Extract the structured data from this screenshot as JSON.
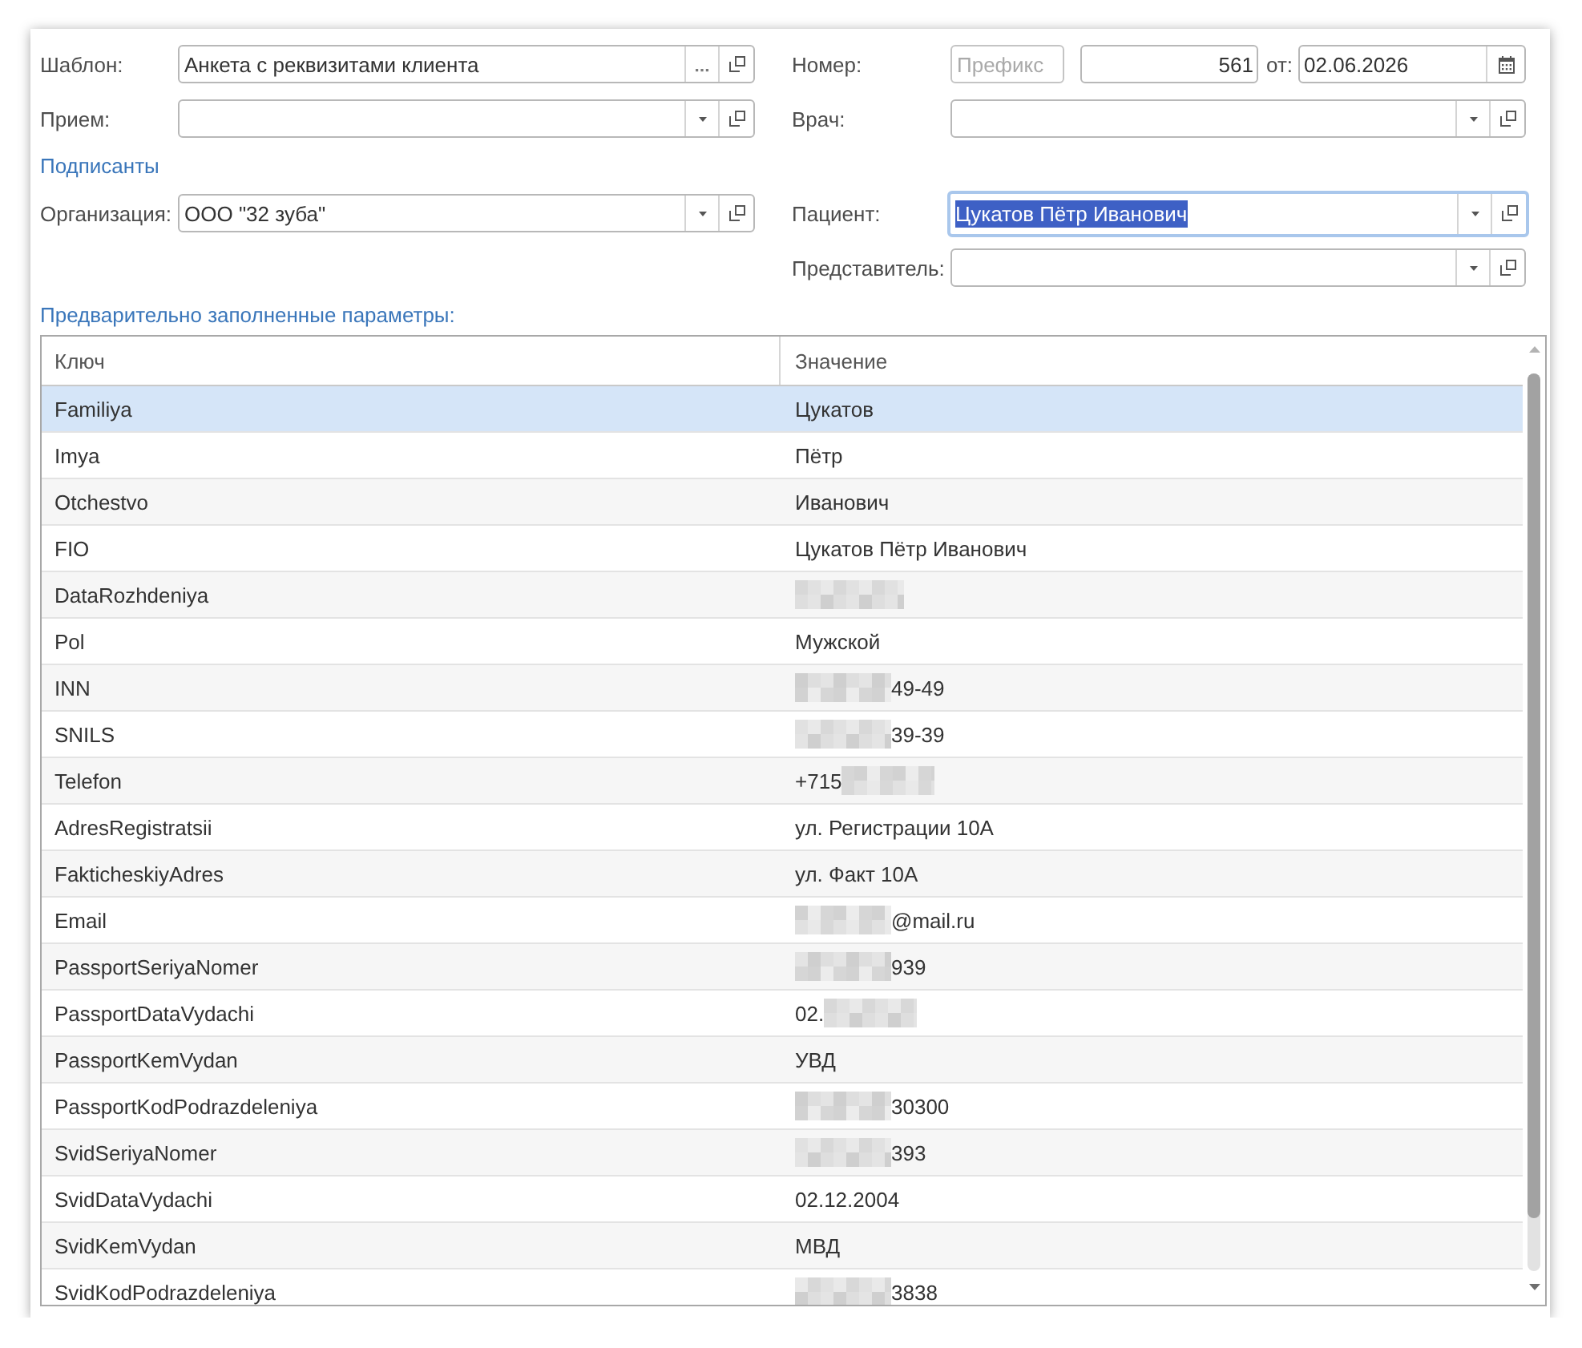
{
  "top_fields": {
    "left": [
      {
        "kind": "choice",
        "label": "Шаблон:",
        "value": "Анкета с реквизитами клиента",
        "focused": false
      },
      {
        "kind": "dropdown",
        "label": "Прием:",
        "focused": false
      }
    ],
    "right": [
      {
        "kind": "number",
        "label": "Номер:",
        "prefix": {
          "placeholder": "Префикс"
        },
        "number": "561",
        "date_label": "от:",
        "date": "02.06.2026"
      },
      {
        "kind": "dropdown",
        "label": "Врач:",
        "focused": false
      }
    ]
  },
  "signatories": {
    "title": "Подписанты",
    "left": [
      {
        "kind": "dropdown",
        "label": "Организация:",
        "value": "ООО \"32 зуба\"",
        "focused": false
      }
    ],
    "right": [
      {
        "kind": "dropdown",
        "label": "Пациент:",
        "value": "Цукатов Пётр Иванович",
        "focused": true
      },
      {
        "kind": "dropdown",
        "label": "Представитель:",
        "focused": false
      }
    ]
  },
  "parameters": {
    "title": "Предварительно заполненные параметры:",
    "columns": [
      "Ключ",
      "Значение"
    ],
    "rows": [
      {
        "kind": "text",
        "key": "Familiya",
        "value": "Цукатов",
        "selected": true
      },
      {
        "kind": "text",
        "key": "Imya",
        "value": "Пётр",
        "selected": false
      },
      {
        "kind": "text",
        "key": "Otchestvo",
        "value": "Иванович",
        "selected": false
      },
      {
        "kind": "text",
        "key": "FIO",
        "value": "Цукатов Пётр Иванович",
        "selected": false
      },
      {
        "kind": "redacted",
        "key": "DataRozhdeniya",
        "selected": false
      },
      {
        "kind": "text",
        "key": "Pol",
        "value": "Мужской",
        "selected": false
      },
      {
        "kind": "redacted_start",
        "key": "INN",
        "value": "49-49",
        "selected": false
      },
      {
        "kind": "redacted_start",
        "key": "SNILS",
        "value": "39-39",
        "selected": false
      },
      {
        "kind": "redacted_end",
        "key": "Telefon",
        "value": "+715",
        "selected": false
      },
      {
        "kind": "text",
        "key": "AdresRegistratsii",
        "value": "ул. Регистрации 10А",
        "selected": false
      },
      {
        "kind": "text",
        "key": "FakticheskiyAdres",
        "value": "ул. Факт 10А",
        "selected": false
      },
      {
        "kind": "redacted_start",
        "key": "Email",
        "value": "@mail.ru",
        "selected": false
      },
      {
        "kind": "redacted_start",
        "key": "PassportSeriyaNomer",
        "value": "939",
        "selected": false
      },
      {
        "kind": "redacted_end",
        "key": "PassportDataVydachi",
        "value": "02.",
        "selected": false
      },
      {
        "kind": "text",
        "key": "PassportKemVydan",
        "value": "УВД",
        "selected": false
      },
      {
        "kind": "redacted_start",
        "key": "PassportKodPodrazdeleniya",
        "value": "30300",
        "selected": false
      },
      {
        "kind": "redacted_start",
        "key": "SvidSeriyaNomer",
        "value": "393",
        "selected": false
      },
      {
        "kind": "text",
        "key": "SvidDataVydachi",
        "value": "02.12.2004",
        "selected": false
      },
      {
        "kind": "text",
        "key": "SvidKemVydan",
        "value": "МВД",
        "selected": false
      },
      {
        "kind": "redacted_start",
        "key": "SvidKodPodrazdeleniya",
        "value": "3838",
        "selected": false
      }
    ]
  }
}
